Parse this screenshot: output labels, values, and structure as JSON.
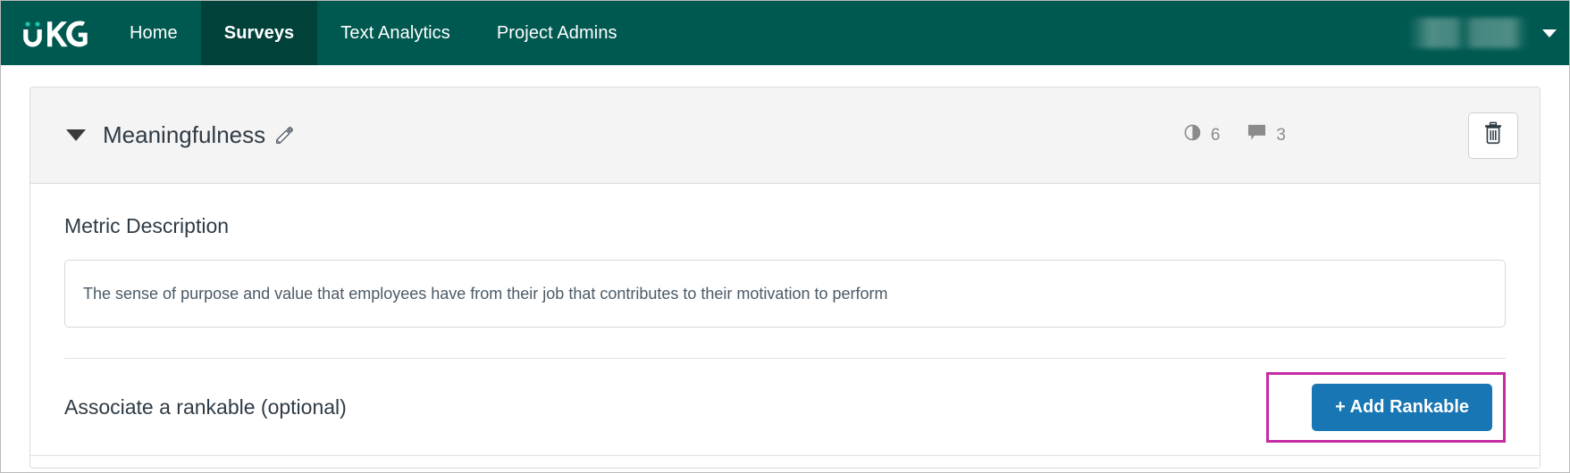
{
  "navbar": {
    "logo_alt": "UKG",
    "items": [
      {
        "label": "Home",
        "active": false
      },
      {
        "label": "Surveys",
        "active": true
      },
      {
        "label": "Text Analytics",
        "active": false
      },
      {
        "label": "Project Admins",
        "active": false
      }
    ],
    "user_menu": {
      "name_redacted": "",
      "caret": "▼"
    },
    "colors": {
      "background": "#005950",
      "active_tab": "#00413a",
      "logo_accent": "#1fc1b0"
    }
  },
  "card": {
    "title": "Meaningfulness",
    "edit_icon": "pencil-icon",
    "collapse_state": "expanded",
    "stats": [
      {
        "icon": "contrast-icon",
        "value": "6"
      },
      {
        "icon": "comment-icon",
        "value": "3"
      }
    ],
    "delete_icon": "trash-icon"
  },
  "metric_description": {
    "heading": "Metric Description",
    "value": "The sense of purpose and value that employees have from their job that contributes to their motivation to perform",
    "placeholder": "Metric description"
  },
  "rankable": {
    "label": "Associate a rankable (optional)",
    "add_button": "+ Add Rankable",
    "highlight_color": "#c42ba5",
    "button_color": "#1876b4"
  }
}
